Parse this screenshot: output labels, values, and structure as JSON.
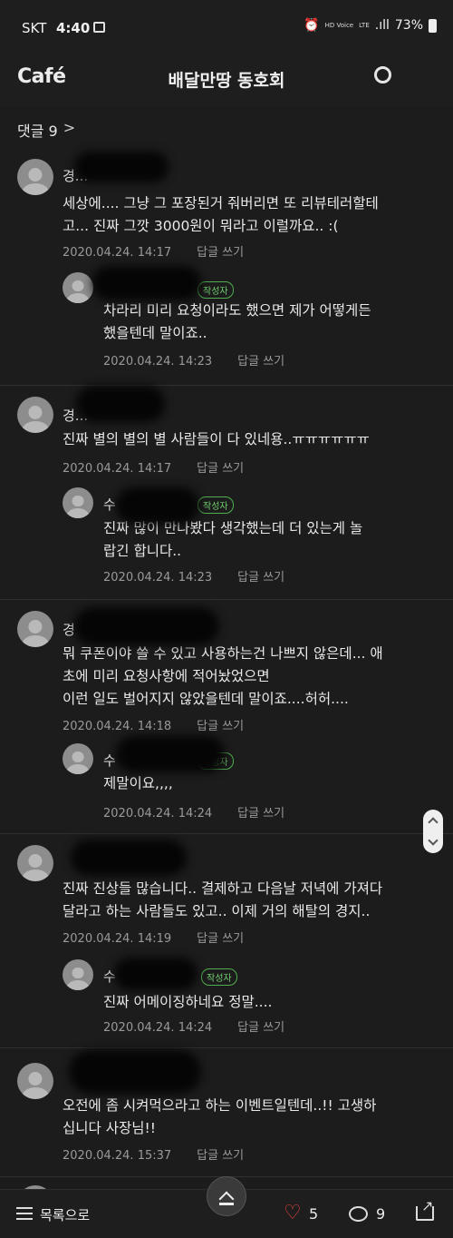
{
  "status_bar": {
    "carrier": "SKT",
    "time": "4:40",
    "lte": "LTE",
    "voice": "HD Voice",
    "battery": "73%"
  },
  "header": {
    "logo": "Café",
    "title": "배달만땅 동호회"
  },
  "comments_header": {
    "label": "댓글 9",
    "chevron": ">"
  },
  "reply_label": "답글 쓰기",
  "writer_badge": "작성자",
  "comments": [
    {
      "nick": "경...",
      "lines": [
        "세상에.... 그냥 그 포장된거 줘버리면 또 리뷰테러할테",
        "고... 진짜 그깟 3000원이 뭐라고 이럴까요.. :("
      ],
      "date": "2020.04.24. 14:17",
      "reply": {
        "nick": "",
        "lines": [
          "차라리 미리 요청이라도 했으면 제가 어떻게든",
          "했을텐데 말이죠.."
        ],
        "date": "2020.04.24. 14:23"
      }
    },
    {
      "nick": "경...",
      "lines": [
        "진짜 별의 별의 별 사람들이 다 있네용..ㅠㅠㅠㅠㅠㅠ"
      ],
      "date": "2020.04.24. 14:17",
      "reply": {
        "nick": "수",
        "lines": [
          "진짜 많이 만나봤다 생각했는데 더 있는게 놀",
          "랍긴 합니다.."
        ],
        "date": "2020.04.24. 14:23"
      }
    },
    {
      "nick": "경",
      "lines": [
        "뭐 쿠폰이야 쓸 수 있고 사용하는건 나쁘지 않은데... 애",
        "초에 미리 요청사항에 적어놨었으면",
        "이런 일도 벌어지지 않았을텐데 말이죠....허허...."
      ],
      "date": "2020.04.24. 14:18",
      "reply": {
        "nick": "수",
        "lines": [
          "제말이요,,,,"
        ],
        "date": "2020.04.24. 14:24"
      }
    },
    {
      "nick": "",
      "lines": [
        "진짜 진상들 많습니다.. 결제하고 다음날 저녁에 가져다",
        "달라고 하는 사람들도 있고.. 이제 거의 해탈의 경지.."
      ],
      "date": "2020.04.24. 14:19",
      "reply": {
        "nick": "수",
        "lines": [
          "진짜 어메이징하네요 정말...."
        ],
        "date": "2020.04.24. 14:24"
      }
    },
    {
      "nick": "",
      "lines": [
        "오전에 좀 시켜먹으라고 하는 이벤트일텐데..!! 고생하",
        "십니다 사장님!!"
      ],
      "date": "2020.04.24. 15:37",
      "reply": null
    }
  ],
  "bottom_bar": {
    "back_label": "목록으로",
    "like_count": "5",
    "comment_count": "9"
  },
  "icons": [
    "gallery-icon",
    "alarm-icon",
    "signal-icon",
    "battery-icon",
    "refresh-icon",
    "chevron-right-icon",
    "scroll-handle-icon",
    "scroll-top-icon",
    "list-icon",
    "heart-icon",
    "comment-icon",
    "share-icon"
  ],
  "colors": {
    "background": "#1c1c1c",
    "writer_badge": "#4fae4f",
    "like": "#e0403f"
  }
}
